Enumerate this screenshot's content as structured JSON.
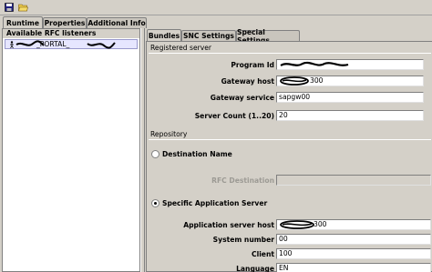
{
  "outer_tabs": [
    "Runtime",
    "Properties",
    "Additional Info"
  ],
  "left_panel": {
    "header": "Available RFC listeners",
    "item_visible_text": "_PORTAL_"
  },
  "inner_tabs": [
    "Bundles",
    "SNC Settings",
    "Special Settings"
  ],
  "registered_server": {
    "title": "Registered server",
    "program_id_label": "Program Id",
    "gateway_host_label": "Gateway host",
    "gateway_host_suffix": "300",
    "gateway_service_label": "Gateway service",
    "gateway_service_value": "sapgw00",
    "server_count_label": "Server Count (1..20)",
    "server_count_value": "20"
  },
  "repository": {
    "title": "Repository",
    "destination_name_label": "Destination Name",
    "rfc_destination_label": "RFC Destination",
    "specific_app_server_label": "Specific Application Server",
    "app_server_host_label": "Application server host",
    "app_server_host_suffix": "300",
    "system_number_label": "System number",
    "system_number_value": "00",
    "client_label": "Client",
    "client_value": "100",
    "language_label": "Language",
    "language_value": "EN"
  },
  "icons": {
    "save": "save-icon",
    "open": "open-folder-icon",
    "listener": "person-icon"
  }
}
